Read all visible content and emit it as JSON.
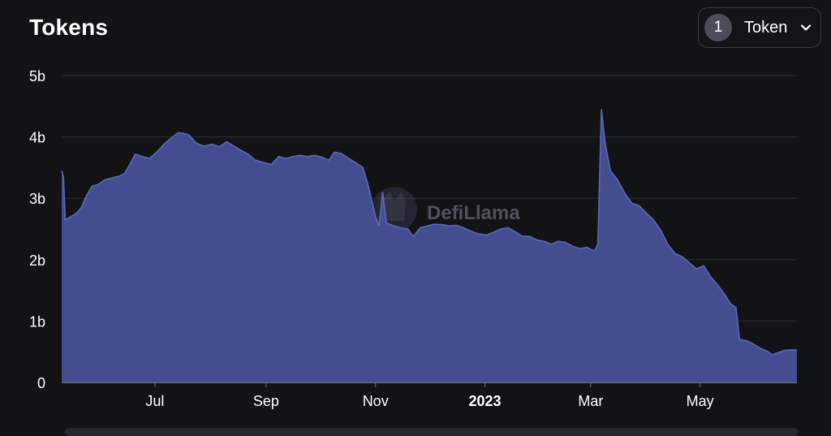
{
  "header": {
    "title": "Tokens",
    "selector": {
      "count": "1",
      "label": "Token",
      "icon": "chevron-down-icon"
    }
  },
  "watermark": "DefiLlama",
  "colors": {
    "background": "#111315",
    "area_fill": "#48529A",
    "area_line": "#5C67BC",
    "grid": "#2a2d31",
    "axis_text": "#ffffff"
  },
  "chart_data": {
    "type": "area",
    "title": "Tokens",
    "xlabel": "",
    "ylabel": "",
    "ylim": [
      0,
      5000000000
    ],
    "yticks": [
      {
        "value": 0,
        "label": "0"
      },
      {
        "value": 1000000000,
        "label": "1b"
      },
      {
        "value": 2000000000,
        "label": "2b"
      },
      {
        "value": 3000000000,
        "label": "3b"
      },
      {
        "value": 4000000000,
        "label": "4b"
      },
      {
        "value": 5000000000,
        "label": "5b"
      }
    ],
    "xlim": [
      "2022-05-10",
      "2023-06-24"
    ],
    "xticks": [
      {
        "date": "2022-07-01",
        "label": "Jul",
        "bold": false
      },
      {
        "date": "2022-09-01",
        "label": "Sep",
        "bold": false
      },
      {
        "date": "2022-11-01",
        "label": "Nov",
        "bold": false
      },
      {
        "date": "2023-01-01",
        "label": "2023",
        "bold": true
      },
      {
        "date": "2023-03-01",
        "label": "Mar",
        "bold": false
      },
      {
        "date": "2023-05-01",
        "label": "May",
        "bold": false
      }
    ],
    "grid": true,
    "series": [
      {
        "points": [
          [
            "2022-05-10",
            3450000000.0
          ],
          [
            "2022-05-11",
            3350000000.0
          ],
          [
            "2022-05-12",
            2650000000.0
          ],
          [
            "2022-05-15",
            2700000000.0
          ],
          [
            "2022-05-18",
            2750000000.0
          ],
          [
            "2022-05-21",
            2850000000.0
          ],
          [
            "2022-05-24",
            3050000000.0
          ],
          [
            "2022-05-27",
            3200000000.0
          ],
          [
            "2022-05-30",
            3220000000.0
          ],
          [
            "2022-06-03",
            3300000000.0
          ],
          [
            "2022-06-07",
            3330000000.0
          ],
          [
            "2022-06-11",
            3360000000.0
          ],
          [
            "2022-06-14",
            3400000000.0
          ],
          [
            "2022-06-17",
            3550000000.0
          ],
          [
            "2022-06-20",
            3720000000.0
          ],
          [
            "2022-06-24",
            3680000000.0
          ],
          [
            "2022-06-28",
            3650000000.0
          ],
          [
            "2022-07-02",
            3750000000.0
          ],
          [
            "2022-07-06",
            3880000000.0
          ],
          [
            "2022-07-10",
            3980000000.0
          ],
          [
            "2022-07-14",
            4070000000.0
          ],
          [
            "2022-07-17",
            4060000000.0
          ],
          [
            "2022-07-20",
            4030000000.0
          ],
          [
            "2022-07-24",
            3900000000.0
          ],
          [
            "2022-07-28",
            3850000000.0
          ],
          [
            "2022-08-02",
            3880000000.0
          ],
          [
            "2022-08-06",
            3840000000.0
          ],
          [
            "2022-08-10",
            3920000000.0
          ],
          [
            "2022-08-14",
            3850000000.0
          ],
          [
            "2022-08-18",
            3780000000.0
          ],
          [
            "2022-08-22",
            3720000000.0
          ],
          [
            "2022-08-26",
            3620000000.0
          ],
          [
            "2022-08-31",
            3580000000.0
          ],
          [
            "2022-09-04",
            3550000000.0
          ],
          [
            "2022-09-08",
            3680000000.0
          ],
          [
            "2022-09-12",
            3650000000.0
          ],
          [
            "2022-09-16",
            3680000000.0
          ],
          [
            "2022-09-20",
            3700000000.0
          ],
          [
            "2022-09-24",
            3680000000.0
          ],
          [
            "2022-09-28",
            3700000000.0
          ],
          [
            "2022-10-02",
            3670000000.0
          ],
          [
            "2022-10-06",
            3620000000.0
          ],
          [
            "2022-10-09",
            3750000000.0
          ],
          [
            "2022-10-13",
            3730000000.0
          ],
          [
            "2022-10-17",
            3650000000.0
          ],
          [
            "2022-10-21",
            3580000000.0
          ],
          [
            "2022-10-25",
            3500000000.0
          ],
          [
            "2022-10-28",
            3200000000.0
          ],
          [
            "2022-11-01",
            2700000000.0
          ],
          [
            "2022-11-03",
            2550000000.0
          ],
          [
            "2022-11-05",
            3100000000.0
          ],
          [
            "2022-11-07",
            2600000000.0
          ],
          [
            "2022-11-11",
            2550000000.0
          ],
          [
            "2022-11-15",
            2520000000.0
          ],
          [
            "2022-11-19",
            2500000000.0
          ],
          [
            "2022-11-22",
            2380000000.0
          ],
          [
            "2022-11-26",
            2520000000.0
          ],
          [
            "2022-11-30",
            2550000000.0
          ],
          [
            "2022-12-04",
            2580000000.0
          ],
          [
            "2022-12-08",
            2570000000.0
          ],
          [
            "2022-12-12",
            2550000000.0
          ],
          [
            "2022-12-16",
            2560000000.0
          ],
          [
            "2022-12-20",
            2520000000.0
          ],
          [
            "2022-12-24",
            2470000000.0
          ],
          [
            "2022-12-28",
            2420000000.0
          ],
          [
            "2023-01-02",
            2400000000.0
          ],
          [
            "2023-01-06",
            2450000000.0
          ],
          [
            "2023-01-10",
            2500000000.0
          ],
          [
            "2023-01-14",
            2520000000.0
          ],
          [
            "2023-01-18",
            2450000000.0
          ],
          [
            "2023-01-22",
            2380000000.0
          ],
          [
            "2023-01-26",
            2380000000.0
          ],
          [
            "2023-01-30",
            2320000000.0
          ],
          [
            "2023-02-03",
            2300000000.0
          ],
          [
            "2023-02-07",
            2250000000.0
          ],
          [
            "2023-02-11",
            2300000000.0
          ],
          [
            "2023-02-15",
            2280000000.0
          ],
          [
            "2023-02-19",
            2220000000.0
          ],
          [
            "2023-02-23",
            2180000000.0
          ],
          [
            "2023-02-27",
            2200000000.0
          ],
          [
            "2023-03-03",
            2140000000.0
          ],
          [
            "2023-03-05",
            2250000000.0
          ],
          [
            "2023-03-07",
            4450000000.0
          ],
          [
            "2023-03-09",
            3900000000.0
          ],
          [
            "2023-03-12",
            3450000000.0
          ],
          [
            "2023-03-16",
            3300000000.0
          ],
          [
            "2023-03-20",
            3080000000.0
          ],
          [
            "2023-03-24",
            2920000000.0
          ],
          [
            "2023-03-28",
            2880000000.0
          ],
          [
            "2023-04-01",
            2760000000.0
          ],
          [
            "2023-04-05",
            2650000000.0
          ],
          [
            "2023-04-09",
            2480000000.0
          ],
          [
            "2023-04-13",
            2250000000.0
          ],
          [
            "2023-04-17",
            2100000000.0
          ],
          [
            "2023-04-21",
            2050000000.0
          ],
          [
            "2023-04-25",
            1950000000.0
          ],
          [
            "2023-04-29",
            1850000000.0
          ],
          [
            "2023-05-03",
            1900000000.0
          ],
          [
            "2023-05-07",
            1720000000.0
          ],
          [
            "2023-05-11",
            1580000000.0
          ],
          [
            "2023-05-15",
            1420000000.0
          ],
          [
            "2023-05-18",
            1280000000.0
          ],
          [
            "2023-05-21",
            1220000000.0
          ],
          [
            "2023-05-23",
            700000000.0
          ],
          [
            "2023-05-27",
            680000000.0
          ],
          [
            "2023-05-31",
            620000000.0
          ],
          [
            "2023-06-04",
            550000000.0
          ],
          [
            "2023-06-08",
            500000000.0
          ],
          [
            "2023-06-10",
            450000000.0
          ],
          [
            "2023-06-13",
            480000000.0
          ],
          [
            "2023-06-17",
            520000000.0
          ],
          [
            "2023-06-21",
            530000000.0
          ],
          [
            "2023-06-24",
            530000000.0
          ]
        ]
      }
    ]
  }
}
